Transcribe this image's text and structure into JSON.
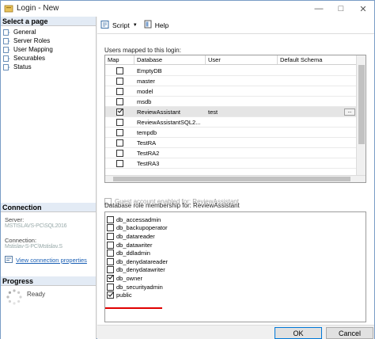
{
  "window": {
    "title": "Login - New"
  },
  "left": {
    "select_page_header": "Select a page",
    "pages": [
      {
        "label": "General"
      },
      {
        "label": "Server Roles"
      },
      {
        "label": "User Mapping"
      },
      {
        "label": "Securables"
      },
      {
        "label": "Status"
      }
    ],
    "connection_header": "Connection",
    "server_label": "Server:",
    "server_value": "MSTISLAVS-PC\\SQL2016",
    "connection_label": "Connection:",
    "connection_value": "Mstislav-S-PC\\Mstislav.S",
    "view_link": "View connection properties",
    "progress_header": "Progress",
    "progress_status": "Ready"
  },
  "toolbar": {
    "script_label": "Script",
    "help_label": "Help"
  },
  "users_mapped": {
    "label": "Users mapped to this login:",
    "columns": [
      "Map",
      "Database",
      "User",
      "Default Schema"
    ],
    "rows": [
      {
        "checked": false,
        "database": "EmptyDB",
        "user": "",
        "schema": ""
      },
      {
        "checked": false,
        "database": "master",
        "user": "",
        "schema": ""
      },
      {
        "checked": false,
        "database": "model",
        "user": "",
        "schema": ""
      },
      {
        "checked": false,
        "database": "msdb",
        "user": "",
        "schema": ""
      },
      {
        "checked": true,
        "database": "ReviewAssistant",
        "user": "test",
        "schema": ""
      },
      {
        "checked": false,
        "database": "ReviewAssistantSQL2...",
        "user": "",
        "schema": ""
      },
      {
        "checked": false,
        "database": "tempdb",
        "user": "",
        "schema": ""
      },
      {
        "checked": false,
        "database": "TestRA",
        "user": "",
        "schema": ""
      },
      {
        "checked": false,
        "database": "TestRA2",
        "user": "",
        "schema": ""
      },
      {
        "checked": false,
        "database": "TestRA3",
        "user": "",
        "schema": ""
      }
    ],
    "ellipsis": "..."
  },
  "guest": {
    "label": "Guest account enabled for: ReviewAssistant"
  },
  "roles": {
    "label": "Database role membership for: ReviewAssistant",
    "items": [
      {
        "name": "db_accessadmin",
        "checked": false
      },
      {
        "name": "db_backupoperator",
        "checked": false
      },
      {
        "name": "db_datareader",
        "checked": false
      },
      {
        "name": "db_datawriter",
        "checked": false
      },
      {
        "name": "db_ddladmin",
        "checked": false
      },
      {
        "name": "db_denydatareader",
        "checked": false
      },
      {
        "name": "db_denydatawriter",
        "checked": false
      },
      {
        "name": "db_owner",
        "checked": true
      },
      {
        "name": "db_securityadmin",
        "checked": false
      },
      {
        "name": "public",
        "checked": true
      }
    ]
  },
  "footer": {
    "ok_label": "OK",
    "cancel_label": "Cancel"
  },
  "colors": {
    "accent": "#0078d7",
    "highlight_underline": "#e00000",
    "section_header_bg": "#e3ebf5"
  }
}
